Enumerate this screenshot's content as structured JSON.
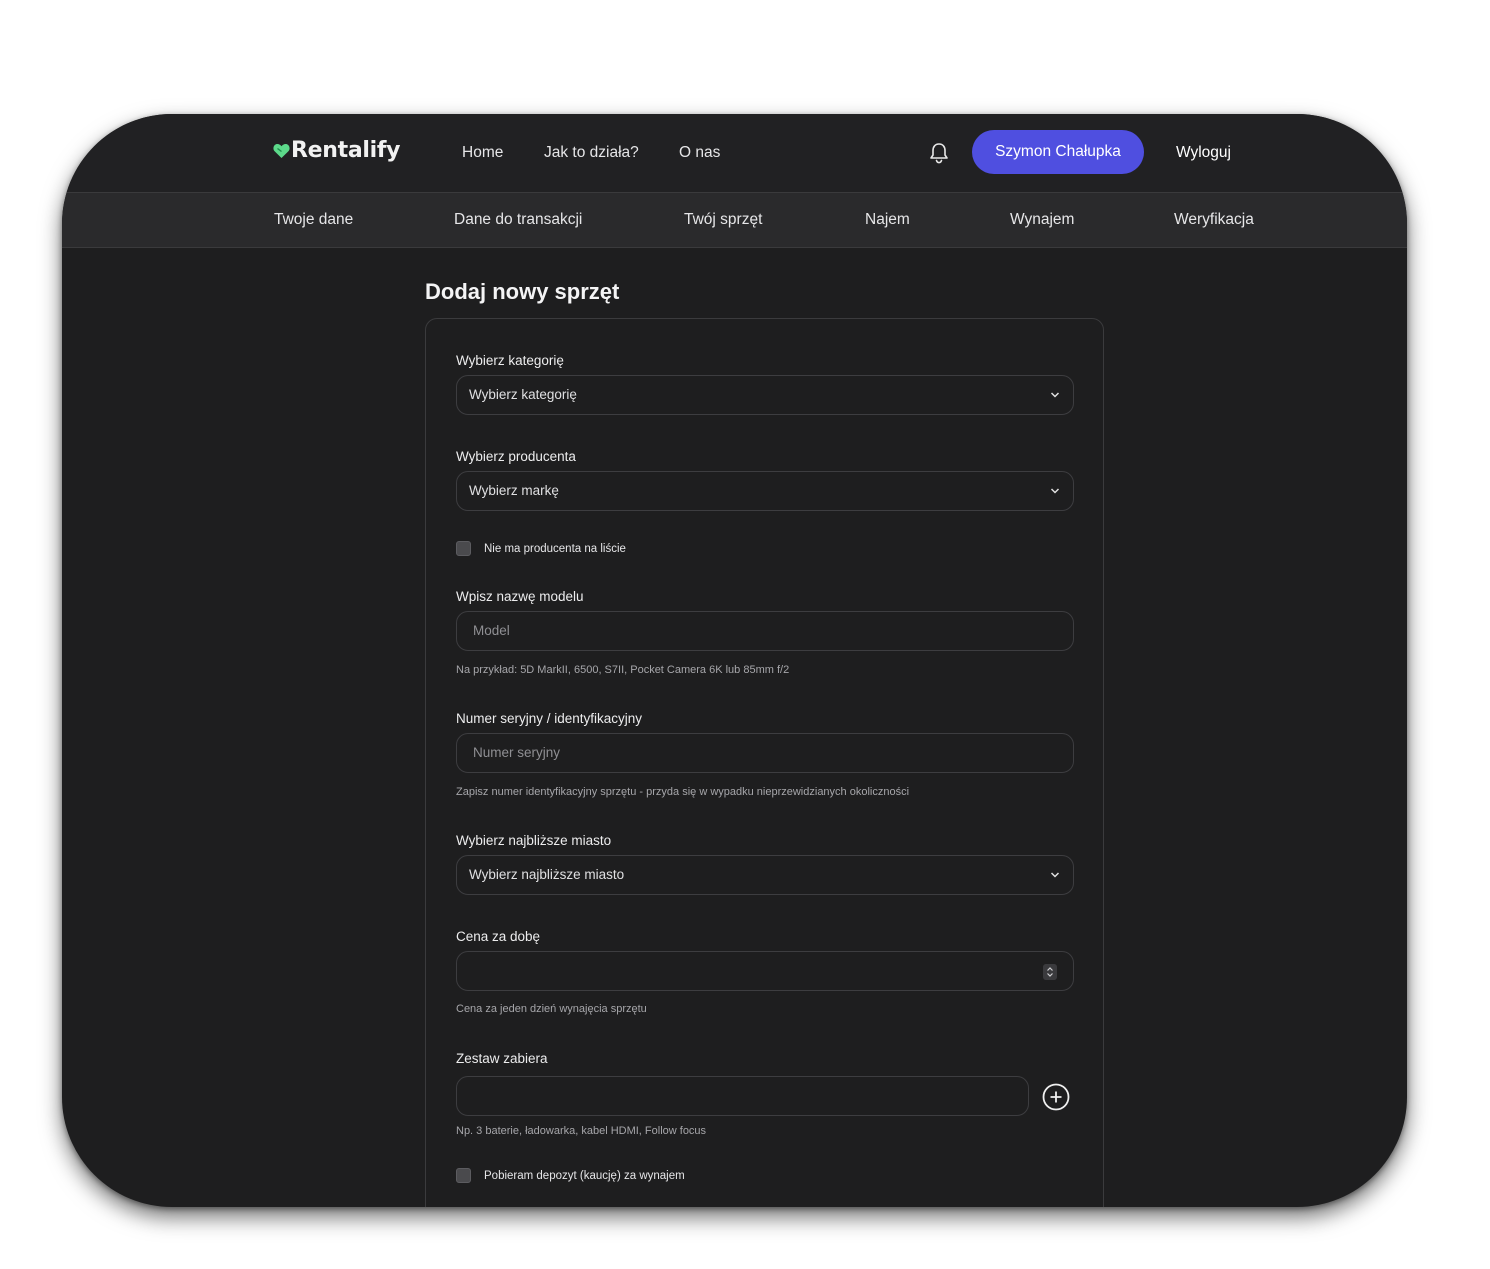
{
  "brand": {
    "name": "Rentalify",
    "accent": "#4f4fe0",
    "logo_color": "#5cd98a"
  },
  "topnav": {
    "links": [
      "Home",
      "Jak to działa?",
      "O nas"
    ],
    "user_button": "Szymon Chałupka",
    "logout": "Wyloguj",
    "notification_icon": "bell-icon"
  },
  "subnav": {
    "items": [
      "Twoje dane",
      "Dane do transakcji",
      "Twój sprzęt",
      "Najem",
      "Wynajem",
      "Weryfikacja"
    ]
  },
  "page": {
    "title": "Dodaj nowy sprzęt"
  },
  "form": {
    "category": {
      "label": "Wybierz kategorię",
      "value": "Wybierz kategorię"
    },
    "producer": {
      "label": "Wybierz producenta",
      "value": "Wybierz markę"
    },
    "no_producer_check": {
      "label": "Nie ma producenta na liście",
      "checked": false
    },
    "model": {
      "label": "Wpisz nazwę modelu",
      "placeholder": "Model",
      "hint": "Na przykład: 5D MarkII, 6500, S7II, Pocket Camera 6K lub 85mm f/2"
    },
    "serial": {
      "label": "Numer seryjny / identyfikacyjny",
      "placeholder": "Numer seryjny",
      "hint": "Zapisz numer identyfikacyjny sprzętu - przyda się w wypadku nieprzewidzianych okoliczności"
    },
    "city": {
      "label": "Wybierz najbliższe miasto",
      "value": "Wybierz najbliższe miasto"
    },
    "price": {
      "label": "Cena za dobę",
      "value": "",
      "hint": "Cena za jeden dzień wynajęcia sprzętu"
    },
    "kit": {
      "label": "Zestaw zabiera",
      "value": "",
      "hint": "Np. 3 baterie, ładowarka, kabel HDMI, Follow focus"
    },
    "deposit_check": {
      "label": "Pobieram depozyt (kaucję) za wynajem",
      "checked": false
    }
  }
}
